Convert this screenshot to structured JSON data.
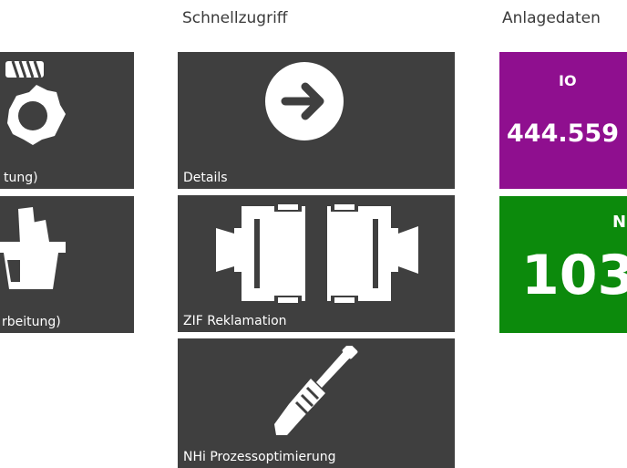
{
  "groups": {
    "quick_access": "Schnellzugriff",
    "plant_data": "Anlagedaten"
  },
  "left_tiles": [
    {
      "label": "tung)",
      "icon": "gear-spring-icon"
    },
    {
      "label": "rbeitung)",
      "icon": "basket-icon"
    }
  ],
  "quick_tiles": [
    {
      "label": "Details",
      "icon": "arrow-right-circle-icon"
    },
    {
      "label": "ZIF Reklamation",
      "icon": "connector-icon"
    },
    {
      "label": "NHi Prozessoptimierung",
      "icon": "screwdriver-icon"
    }
  ],
  "kpis": [
    {
      "label": "IO",
      "value": "444.559",
      "color": "#8f0f8f"
    },
    {
      "label": "N",
      "value": "103",
      "color": "#0c8a0c"
    }
  ],
  "colors": {
    "tile_bg": "#3f3f3f",
    "text": "#ffffff",
    "heading": "#3a3a3a"
  }
}
